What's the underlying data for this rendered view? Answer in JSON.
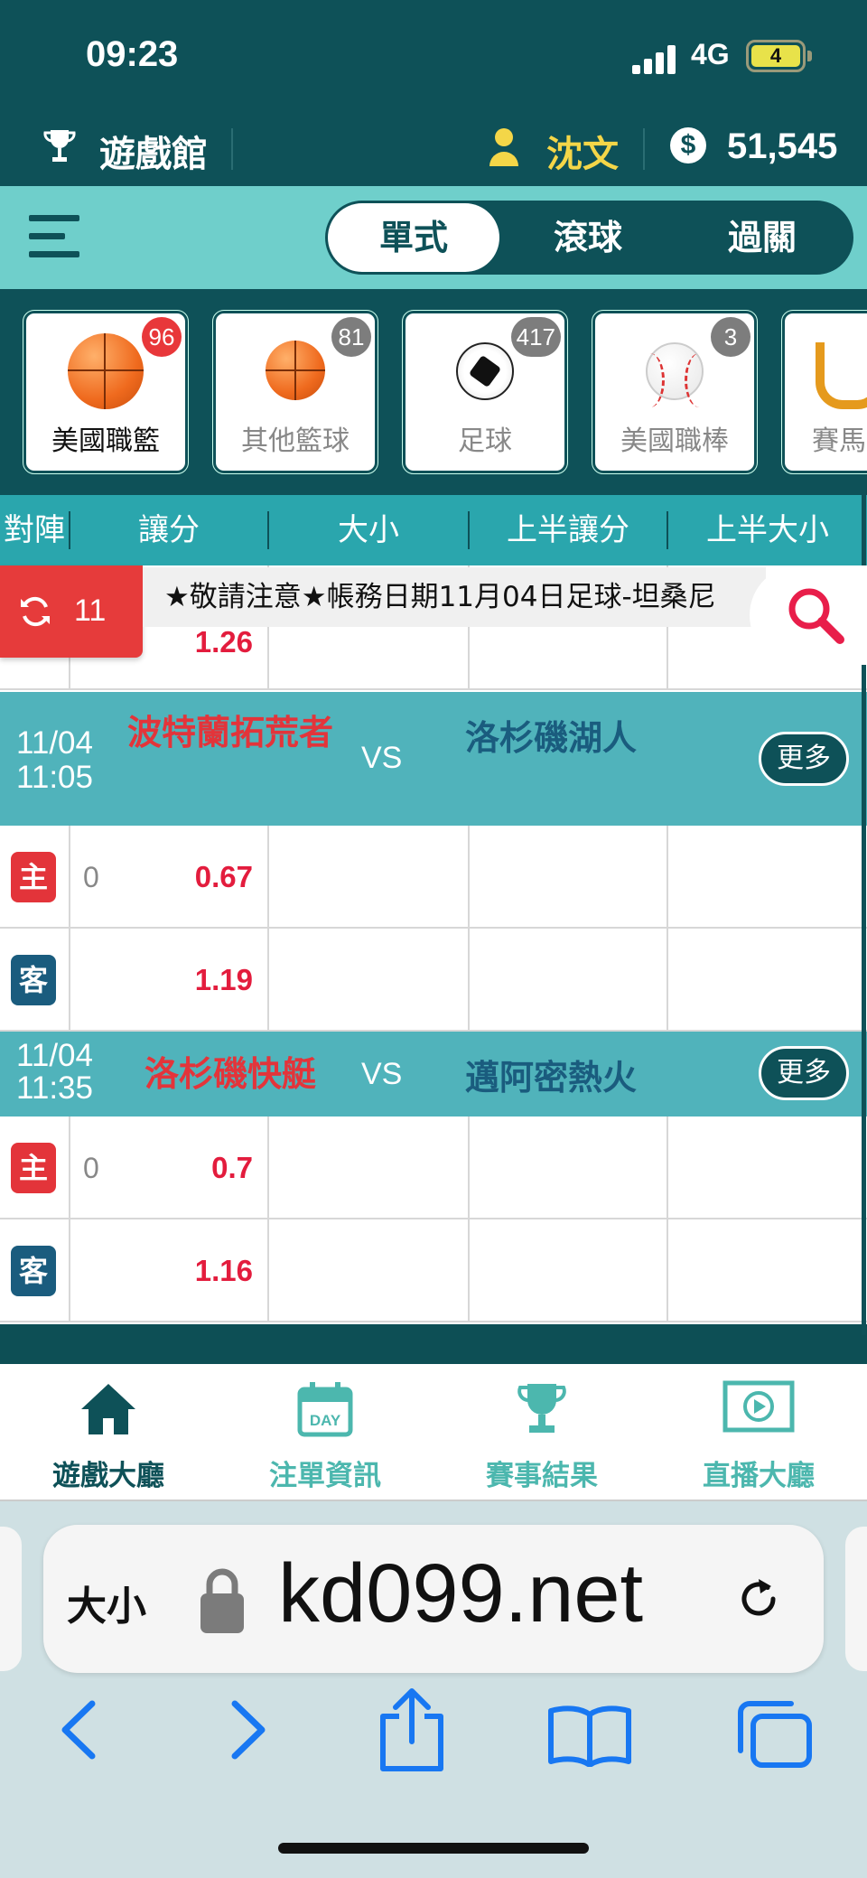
{
  "status": {
    "time": "09:23",
    "network": "4G",
    "battery": "4"
  },
  "header": {
    "title": "遊戲館",
    "username": "沈文",
    "coin_symbol": "$",
    "balance": "51,545"
  },
  "modes": [
    {
      "label": "單式",
      "active": true
    },
    {
      "label": "滾球",
      "active": false
    },
    {
      "label": "過關",
      "active": false
    }
  ],
  "sports": [
    {
      "label": "美國職籃",
      "count": "96",
      "icon": "basketball-icon",
      "active": true
    },
    {
      "label": "其他籃球",
      "count": "81",
      "icon": "basketball-icon",
      "active": false
    },
    {
      "label": "足球",
      "count": "417",
      "icon": "soccer-ball-icon",
      "active": false
    },
    {
      "label": "美國職棒",
      "count": "3",
      "icon": "baseball-icon",
      "active": false
    },
    {
      "label": "賽馬",
      "count": "",
      "icon": "horseshoe-icon",
      "active": false
    }
  ],
  "columns": [
    "對陣",
    "讓分",
    "大小",
    "上半讓分",
    "上半大小"
  ],
  "refresh": {
    "count": "11"
  },
  "notice": "★敬請注意★帳務日期11月04日足球-坦桑尼",
  "partial_row": {
    "odds": "1.26"
  },
  "matches": [
    {
      "date": "11/04",
      "time": "11:05",
      "home": "波特蘭拓荒者",
      "vs": "VS",
      "away": "洛杉磯湖人",
      "more": "更多",
      "rows": [
        {
          "side": "主",
          "hcp": "0",
          "odds": "0.67"
        },
        {
          "side": "客",
          "hcp": "",
          "odds": "1.19"
        }
      ]
    },
    {
      "date": "11/04",
      "time": "11:35",
      "home": "洛杉磯快艇",
      "vs": "VS",
      "away": "邁阿密熱火",
      "more": "更多",
      "rows": [
        {
          "side": "主",
          "hcp": "0",
          "odds": "0.7"
        },
        {
          "side": "客",
          "hcp": "",
          "odds": "1.16"
        }
      ]
    }
  ],
  "nav": [
    {
      "label": "遊戲大廳",
      "icon": "home-icon",
      "active": true
    },
    {
      "label": "注單資訊",
      "icon": "calendar-day-icon",
      "active": false,
      "icon_text": "DAY"
    },
    {
      "label": "賽事結果",
      "icon": "trophy-icon",
      "active": false
    },
    {
      "label": "直播大廳",
      "icon": "live-video-icon",
      "active": false
    }
  ],
  "browser": {
    "text_size": "大小",
    "url": "kd099.net"
  },
  "colors": {
    "dark_teal": "#0e5158",
    "light_teal": "#6fcfcb",
    "header_teal": "#2aa6ad",
    "match_teal": "#50b3bb",
    "red": "#e31c3d",
    "gold": "#f4d648"
  }
}
